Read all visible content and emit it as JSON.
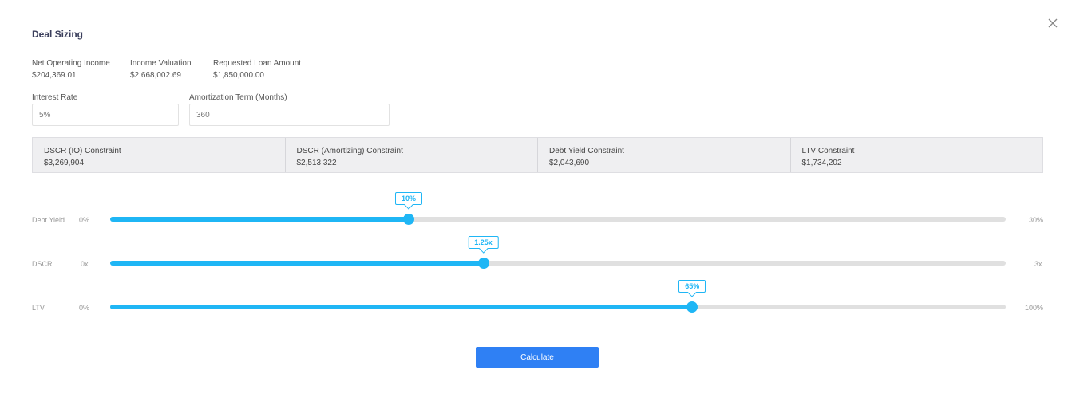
{
  "title": "Deal Sizing",
  "stats": [
    {
      "label": "Net Operating Income",
      "value": "$204,369.01"
    },
    {
      "label": "Income Valuation",
      "value": "$2,668,002.69"
    },
    {
      "label": "Requested Loan Amount",
      "value": "$1,850,000.00"
    }
  ],
  "inputs": {
    "interest_rate": {
      "label": "Interest Rate",
      "value": "5%"
    },
    "amortization": {
      "label": "Amortization Term (Months)",
      "value": "360"
    }
  },
  "constraints": [
    {
      "label": "DSCR (IO) Constraint",
      "value": "$3,269,904"
    },
    {
      "label": "DSCR (Amortizing) Constraint",
      "value": "$2,513,322"
    },
    {
      "label": "Debt Yield Constraint",
      "value": "$2,043,690"
    },
    {
      "label": "LTV Constraint",
      "value": "$1,734,202"
    }
  ],
  "sliders": {
    "debt_yield": {
      "label": "Debt Yield",
      "min": "0%",
      "max": "30%",
      "value_label": "10%",
      "fraction": 0.3333
    },
    "dscr": {
      "label": "DSCR",
      "min": "0x",
      "max": "3x",
      "value_label": "1.25x",
      "fraction": 0.4167
    },
    "ltv": {
      "label": "LTV",
      "min": "0%",
      "max": "100%",
      "value_label": "65%",
      "fraction": 0.65
    }
  },
  "calculate_label": "Calculate",
  "colors": {
    "accent": "#1fb6f5",
    "button": "#2f80f4"
  },
  "icons": {
    "close": "close-icon"
  }
}
